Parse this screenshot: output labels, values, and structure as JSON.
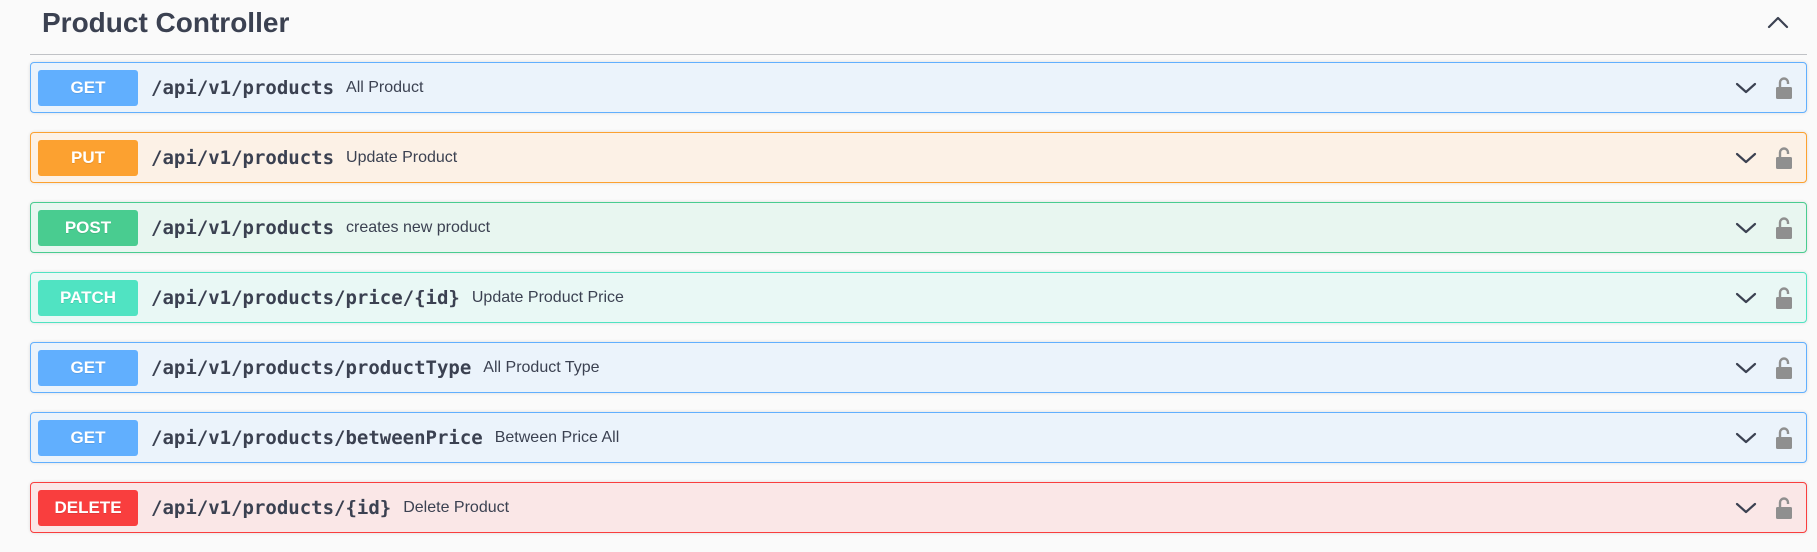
{
  "section": {
    "title": "Product Controller",
    "collapse_icon": "chevron-up-icon"
  },
  "operations": [
    {
      "method": "GET",
      "path": "/api/v1/products",
      "summary": "All Product",
      "color": "#61affe"
    },
    {
      "method": "PUT",
      "path": "/api/v1/products",
      "summary": "Update Product",
      "color": "#fca130"
    },
    {
      "method": "POST",
      "path": "/api/v1/products",
      "summary": "creates new product",
      "color": "#49cc90"
    },
    {
      "method": "PATCH",
      "path": "/api/v1/products/price/{id}",
      "summary": "Update Product Price",
      "color": "#50e3c2"
    },
    {
      "method": "GET",
      "path": "/api/v1/products/productType",
      "summary": "All Product Type",
      "color": "#61affe"
    },
    {
      "method": "GET",
      "path": "/api/v1/products/betweenPrice",
      "summary": "Between Price All",
      "color": "#61affe"
    },
    {
      "method": "DELETE",
      "path": "/api/v1/products/{id}",
      "summary": "Delete Product",
      "color": "#f93e3e"
    }
  ],
  "icons": {
    "expand": "chevron-down-icon",
    "auth": "unlocked-padlock-icon"
  }
}
